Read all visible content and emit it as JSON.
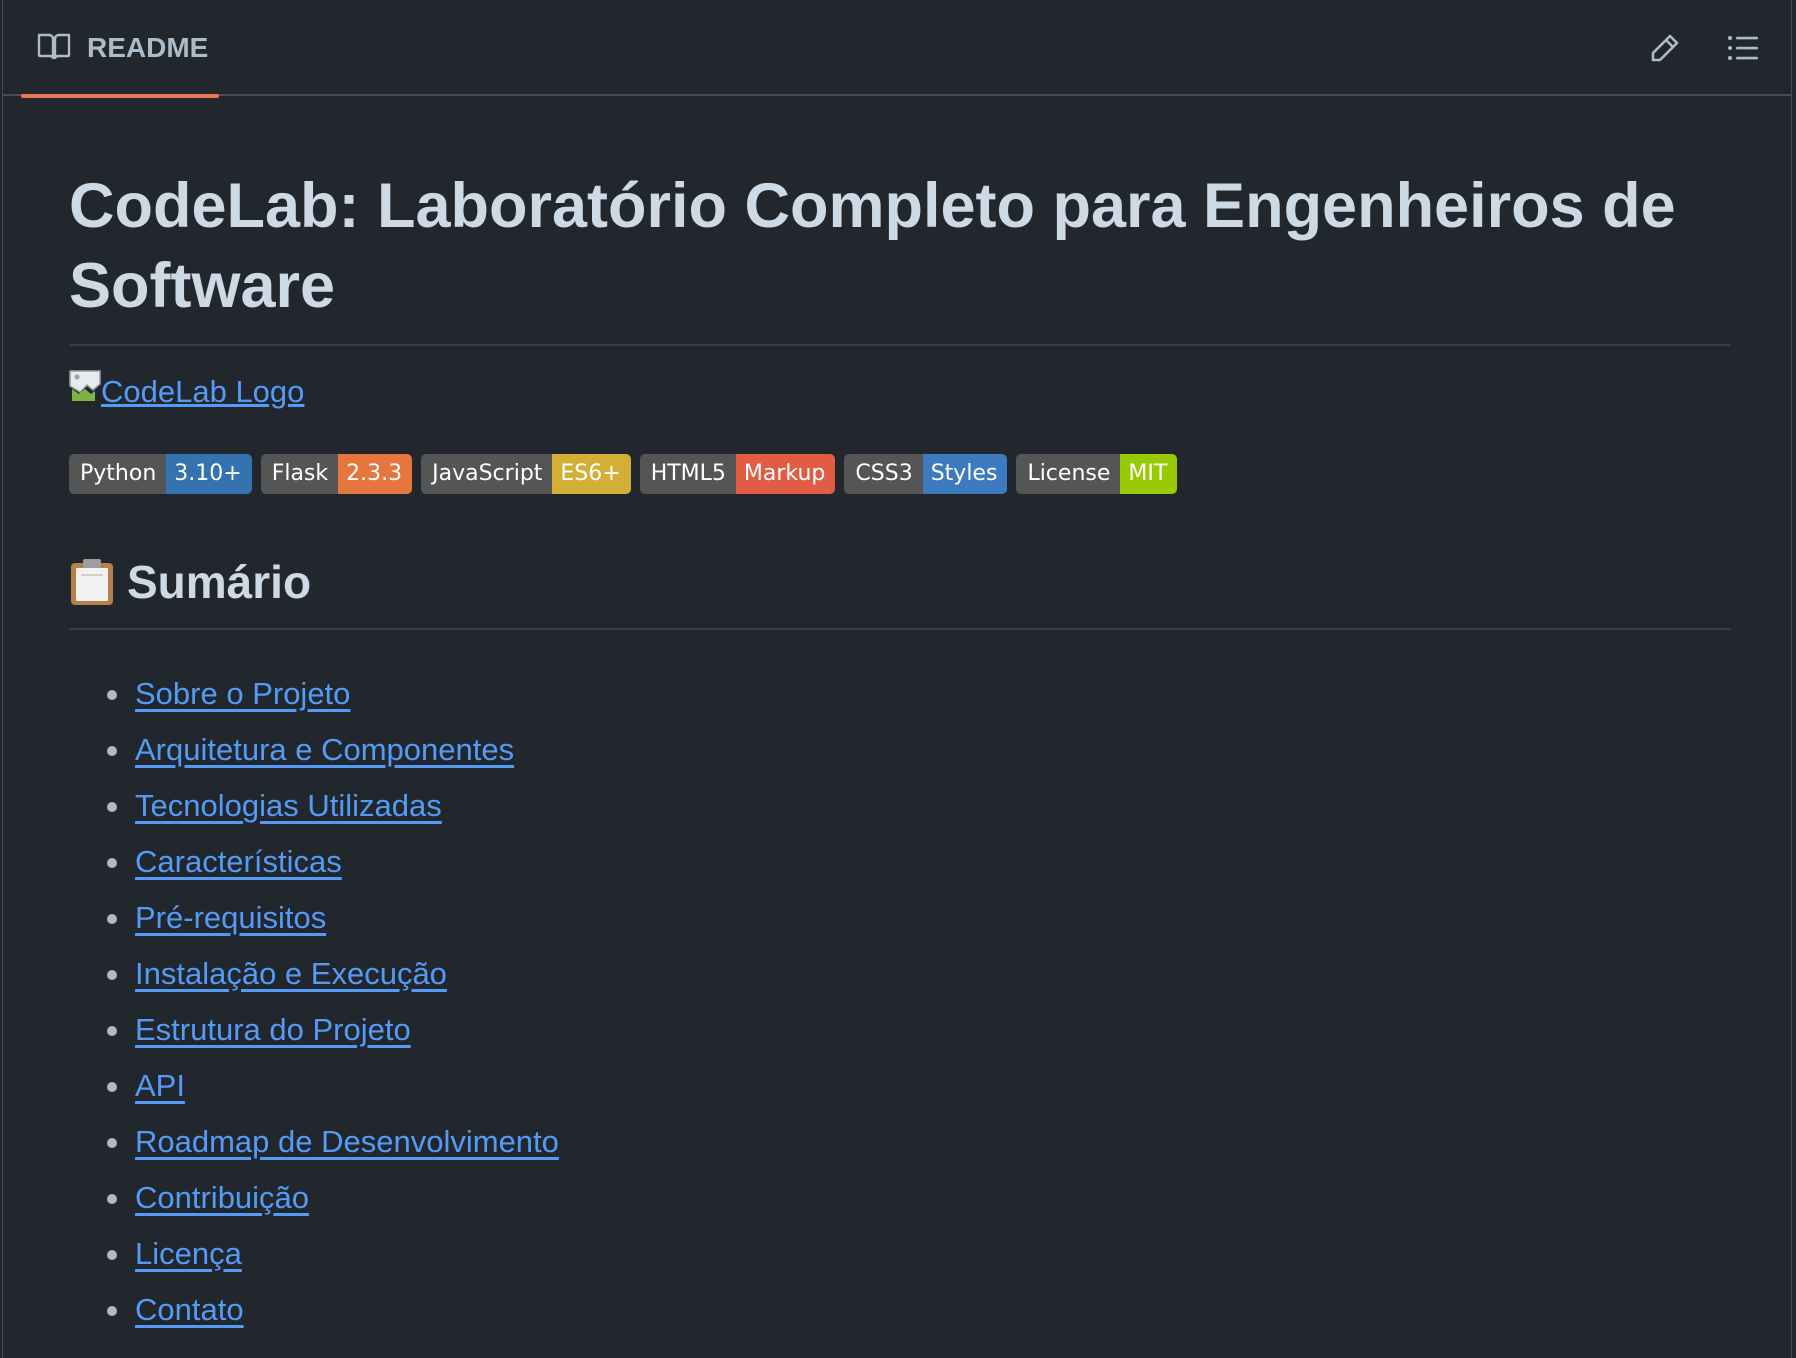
{
  "header": {
    "tab_label": "README",
    "book_icon": "book-open-icon",
    "edit_icon": "pencil-icon",
    "toc_icon": "list-unordered-icon"
  },
  "readme": {
    "title": "CodeLab: Laboratório Completo para Engenheiros de Software",
    "logo_alt": "CodeLab Logo",
    "badges": [
      {
        "label": "Python",
        "message": "3.10+",
        "color": "#3572b0"
      },
      {
        "label": "Flask",
        "message": "2.3.3",
        "color": "#e5773e"
      },
      {
        "label": "JavaScript",
        "message": "ES6+",
        "color": "#d4af37"
      },
      {
        "label": "HTML5",
        "message": "Markup",
        "color": "#e05d44"
      },
      {
        "label": "CSS3",
        "message": "Styles",
        "color": "#3c7bc0"
      },
      {
        "label": "License",
        "message": "MIT",
        "color": "#97ca00"
      }
    ],
    "summary_heading": "Sumário",
    "summary_icon": "clipboard-emoji-icon",
    "toc": [
      "Sobre o Projeto",
      "Arquitetura e Componentes",
      "Tecnologias Utilizadas",
      "Características",
      "Pré-requisitos",
      "Instalação e Execução",
      "Estrutura do Projeto",
      "API",
      "Roadmap de Desenvolvimento",
      "Contribuição",
      "Licença",
      "Contato"
    ]
  },
  "colors": {
    "background": "#22272e",
    "heading_text": "#cdd9e5",
    "link": "#539bf5",
    "tab_underline": "#ec775c",
    "border": "#444c56"
  }
}
